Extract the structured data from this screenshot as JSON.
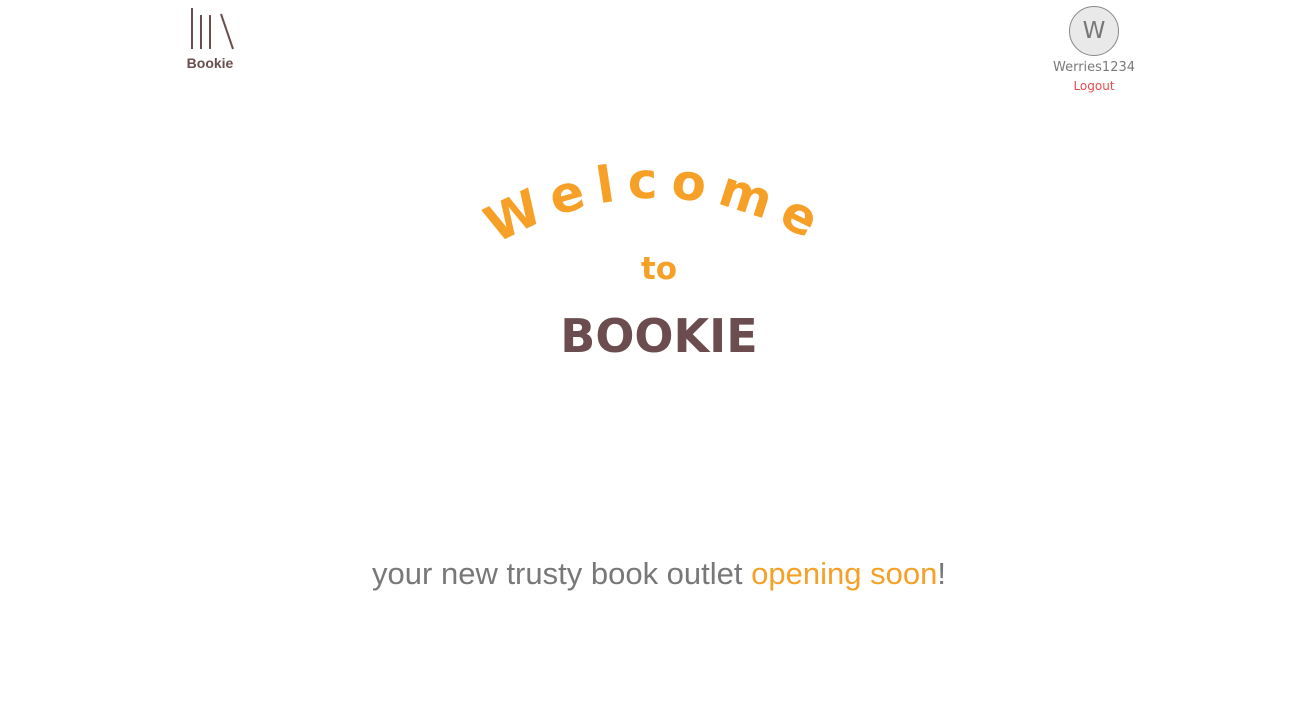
{
  "header": {
    "logo": {
      "icon": "bookshelf-icon",
      "label": "Bookie"
    },
    "user": {
      "avatar_initial": "W",
      "username": "Werries1234",
      "logout_label": "Logout"
    }
  },
  "hero": {
    "welcome": "Welcome",
    "to": "to",
    "brand": "BOOKIE"
  },
  "tagline": {
    "prefix": "your new trusty book outlet ",
    "highlight": "opening soon",
    "suffix": "!"
  },
  "colors": {
    "accent": "#f7a028",
    "brand": "#6b4d4f",
    "logout": "#e84b50",
    "muted": "#787878"
  }
}
